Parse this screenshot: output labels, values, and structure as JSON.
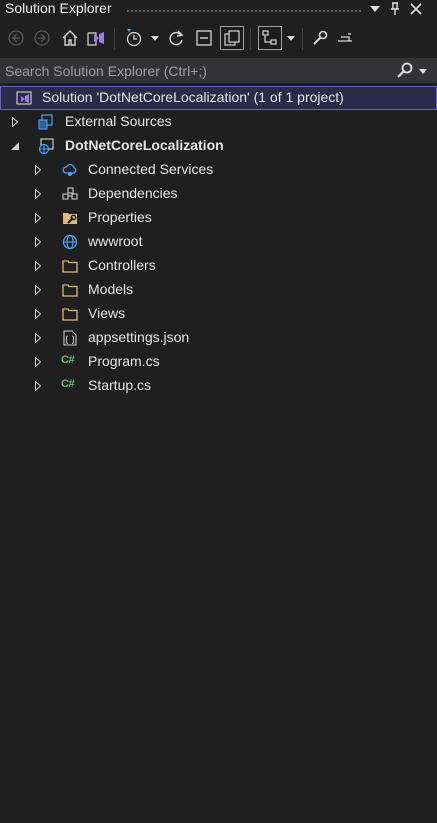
{
  "panel": {
    "title": "Solution Explorer"
  },
  "search": {
    "placeholder": "Search Solution Explorer (Ctrl+;)"
  },
  "solution": {
    "label": "Solution 'DotNetCoreLocalization' (1 of 1 project)"
  },
  "tree": {
    "external": "External Sources",
    "project": "DotNetCoreLocalization",
    "items": [
      {
        "label": "Connected Services",
        "icon": "connected-services-icon"
      },
      {
        "label": "Dependencies",
        "icon": "dependencies-icon"
      },
      {
        "label": "Properties",
        "icon": "properties-icon"
      },
      {
        "label": "wwwroot",
        "icon": "globe-icon"
      },
      {
        "label": "Controllers",
        "icon": "folder-icon"
      },
      {
        "label": "Models",
        "icon": "folder-icon"
      },
      {
        "label": "Views",
        "icon": "folder-icon"
      },
      {
        "label": "appsettings.json",
        "icon": "json-file-icon"
      },
      {
        "label": "Program.cs",
        "icon": "csharp-file-icon"
      },
      {
        "label": "Startup.cs",
        "icon": "csharp-file-icon"
      }
    ]
  },
  "colors": {
    "background": "#1f1f1f",
    "selection": "#2b2a48",
    "selection_border": "#6b5fd6",
    "folder": "#dcb67a",
    "csharp": "#6fbf73"
  }
}
